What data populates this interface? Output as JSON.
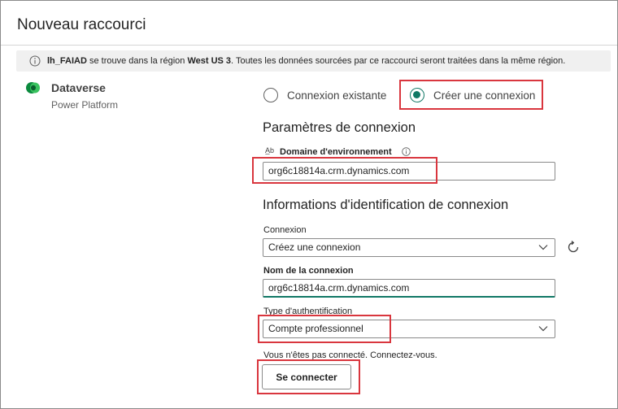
{
  "dialog": {
    "title": "Nouveau raccourci"
  },
  "banner": {
    "name": "lh_FAIAD",
    "text1": " se trouve dans la région ",
    "region": "West US 3",
    "text2": ". Toutes les données sourcées par ce raccourci seront traitées dans la même région."
  },
  "datasource": {
    "name": "Dataverse",
    "platform": "Power Platform",
    "icon": "dataverse-icon"
  },
  "connection_mode": {
    "existing_label": "Connexion existante",
    "new_label": "Créer une connexion",
    "selected": "new"
  },
  "settings": {
    "title": "Paramètres de connexion",
    "domain_label": "Domaine d'environnement",
    "domain_value": "org6c18814a.crm.dynamics.com"
  },
  "credentials": {
    "title": "Informations d'identification de connexion",
    "connection_label": "Connexion",
    "connection_value": "Créez une connexion",
    "name_label": "Nom de la connexion",
    "name_value": "org6c18814a.crm.dynamics.com",
    "auth_label": "Type d'authentification",
    "auth_value": "Compte professionnel",
    "status": "Vous n'êtes pas connecté. Connectez-vous.",
    "signin_button": "Se connecter"
  },
  "colors": {
    "accent": "#117865",
    "highlight": "#d9363e"
  }
}
